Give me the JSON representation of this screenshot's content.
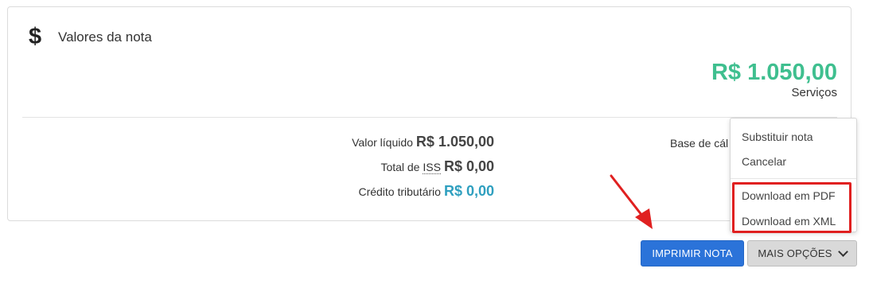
{
  "card": {
    "title": "Valores da nota",
    "icon": "dollar-icon",
    "total_amount": "R$ 1.050,00",
    "total_label": "Serviços",
    "rows": [
      {
        "label": "Valor líquido",
        "value": "R$ 1.050,00"
      },
      {
        "label_prefix": "Total de ",
        "label_abbr": "ISS",
        "value": "R$ 0,00"
      },
      {
        "label": "Crédito tributário",
        "value": "R$ 0,00"
      }
    ],
    "base_calc_label": "Base de cál"
  },
  "dropdown": {
    "items": [
      "Substituir nota",
      "Cancelar",
      "Download em PDF",
      "Download em XML"
    ]
  },
  "buttons": {
    "print_label": "IMPRIMIR NOTA",
    "more_label": "MAIS OPÇÕES"
  },
  "colors": {
    "total_green": "#3fbf8f",
    "credit_teal": "#2e9fbf",
    "primary_blue": "#2b73d9",
    "annotation_red": "#e02020"
  }
}
